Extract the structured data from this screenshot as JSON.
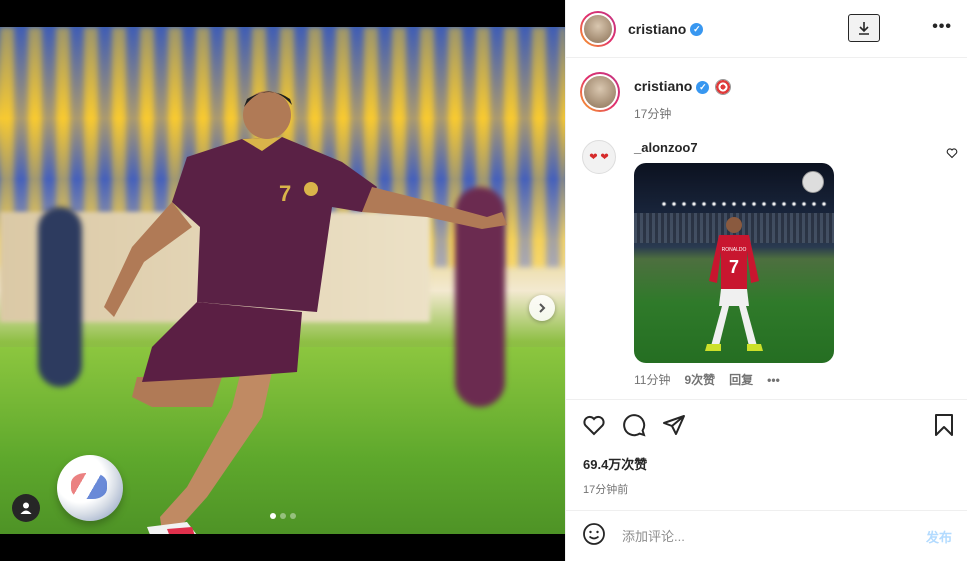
{
  "header": {
    "username": "cristiano",
    "verified_mark": "✓"
  },
  "caption": {
    "username": "cristiano",
    "time": "17分钟"
  },
  "comment": {
    "username": "_alonzoo7",
    "avatar_text": "❤ ❤",
    "time": "11分钟",
    "likes": "9次赞",
    "reply_label": "回复",
    "more": "•••",
    "gif": {
      "player_number": "7",
      "player_name": "RONALDO"
    }
  },
  "post": {
    "jersey_number": "7",
    "likes": "69.4万次赞",
    "date": "17分钟前"
  },
  "add_comment": {
    "placeholder": "添加评论...",
    "post_label": "发布"
  },
  "carousel": {
    "dot_count": 3,
    "active_index": 0
  },
  "colors": {
    "verified": "#3897f0",
    "jersey": "#5a2145",
    "post_button": "#b3dbff"
  },
  "icons": [
    "download-icon",
    "more-options-icon",
    "like-icon",
    "comment-icon",
    "share-icon",
    "save-icon",
    "emoji-icon",
    "next-arrow-icon",
    "user-tag-icon",
    "heart-icon"
  ]
}
